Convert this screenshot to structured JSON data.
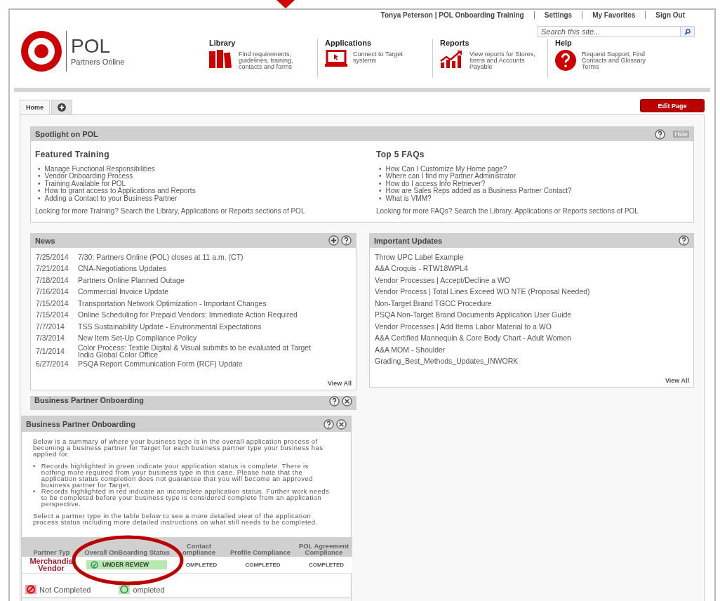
{
  "top_links": [
    {
      "label": "Tonya Peterson | POL Onboarding Training"
    },
    {
      "label": "Settings"
    },
    {
      "label": "My Favorites"
    },
    {
      "label": "Sign Out"
    }
  ],
  "logo": {
    "title": "POL",
    "subtitle": "Partners Online"
  },
  "search": {
    "placeholder": "Search this site..."
  },
  "nav": [
    {
      "kind": "books",
      "title": "Library",
      "desc": "Find requirements, guidelines, training, contacts and forms"
    },
    {
      "kind": "laptop",
      "title": "Applications",
      "desc": "Connect to Target systems"
    },
    {
      "kind": "chart",
      "title": "Reports",
      "desc": "View reports for Stores, Items and Accounts Payable"
    },
    {
      "kind": "help",
      "title": "Help",
      "desc": "Request Support, Find Contacts and Glossary Terms"
    }
  ],
  "tabs": [
    {
      "kind": "text",
      "label": "Home",
      "selected": true
    },
    {
      "kind": "add",
      "selected": false
    }
  ],
  "edit_button": "Edit Page",
  "spotlight": {
    "title": "Spotlight on POL",
    "hide": "Hide",
    "marker": "•",
    "columns": [
      {
        "heading": "Featured Training",
        "items": [
          "Manage Functional Responsibilities",
          "Vendor Onboarding Process",
          "Training Available for POL",
          "How to grant access to Applications and Reports",
          "Adding a Contact to your Business Partner"
        ],
        "footer": "Looking for more Training? Search the Library, Applications or Reports sections of POL"
      },
      {
        "heading": "Top 5 FAQs",
        "items": [
          "How Can I Customize My Home page?",
          "Where can I find my Partner Administrator",
          "How do I access Info Retriever?",
          "How are Sales Reps added as a Business Partner Contact?",
          "What is VMM?"
        ],
        "footer": "Looking for more FAQs? Search the Library, Applications or Reports sections of POL"
      }
    ]
  },
  "news": {
    "title": "News",
    "rows": [
      {
        "date": "7/25/2014",
        "text": "7/30: Partners Online (POL) closes at 11 a.m. (CT)"
      },
      {
        "date": "7/21/2014",
        "text": "CNA-Negotiations Updates"
      },
      {
        "date": "7/18/2014",
        "text": "Partners Online Planned Outage"
      },
      {
        "date": "7/16/2014",
        "text": "Commercial Invoice Update"
      },
      {
        "date": "7/15/2014",
        "text": "Transportation Network Optimization - Important Changes"
      },
      {
        "date": "7/15/2014",
        "text": "Online Scheduling for Prepaid Vendors: Immediate Action Required"
      },
      {
        "date": "7/7/2014",
        "text": "TSS Sustainability Update - Environmental Expectations"
      },
      {
        "date": "7/3/2014",
        "text": "New Item Set-Up Compliance Policy"
      },
      {
        "date": "7/1/2014",
        "text": "Color Process: Textile Digital & Visual submits to be evaluated at Target India Global Color Office"
      },
      {
        "date": "6/27/2014",
        "text": "PSQA Report Communication Form (RCF) Update"
      }
    ],
    "view_all": "View All"
  },
  "updates": {
    "title": "Important Updates",
    "items": [
      "Throw UPC Label Example",
      "A&A Croquis - RTW18WPL4",
      "Vendor Processes | Accept/Decline a WO",
      "Vendor Process | Total Lines Exceed WO NTE (Proposal Needed)",
      "Non-Target Brand TGCC Procedure",
      "PSQA Non-Target Brand Documents Application User Guide",
      "Vendor Processes | Add Items Labor Material to a WO",
      "A&A Certified Mannequin & Core Body Chart - Adult Women",
      "A&A MOM - Shoulder",
      "Grading_Best_Methods_Updates_INWORK"
    ],
    "view_all": "View All"
  },
  "onboarding_behind": {
    "title": "Business Partner Onboarding"
  },
  "onboarding": {
    "title": "Business Partner Onboarding",
    "marker": "•",
    "intro": "Below is a summary of where your business type is in the overall application process of becoming a business partner for Target for each business partner type your business has applied for.",
    "bullets": [
      "Records highlighted in green indicate your application status is complete. There is nothing more required from your business type in this case. Please note that the application status completion does not guarantee that you will become an approved business partner for Target.",
      "Records highlighted in red indicate an incomplete application status. Further work needs to be completed before your business type is considered complete from an application perspective."
    ],
    "select_text": "Select a partner type in the table below to see a more detailed view of the application process status including more detailed instructions on what still needs to be completed.",
    "columns": [
      {
        "label": "Partner Typ",
        "kind": "link"
      },
      {
        "label": "Overall OnBoarding Status",
        "kind": "status"
      },
      {
        "label": "Contact ompliance",
        "kind": "text"
      },
      {
        "label": "Profile Compliance",
        "kind": "text"
      },
      {
        "label": "POL Agreement Compliance",
        "kind": "text"
      }
    ],
    "rows": [
      {
        "cells": [
          "Merchandis Vendor",
          "UNDER REVIEW",
          "OMPLETED",
          "COMPLETED",
          "COMPLETED"
        ]
      }
    ],
    "legend": [
      {
        "kind": "not_completed",
        "label": "Not Completed"
      },
      {
        "kind": "completed",
        "label": "ompleted"
      }
    ]
  }
}
